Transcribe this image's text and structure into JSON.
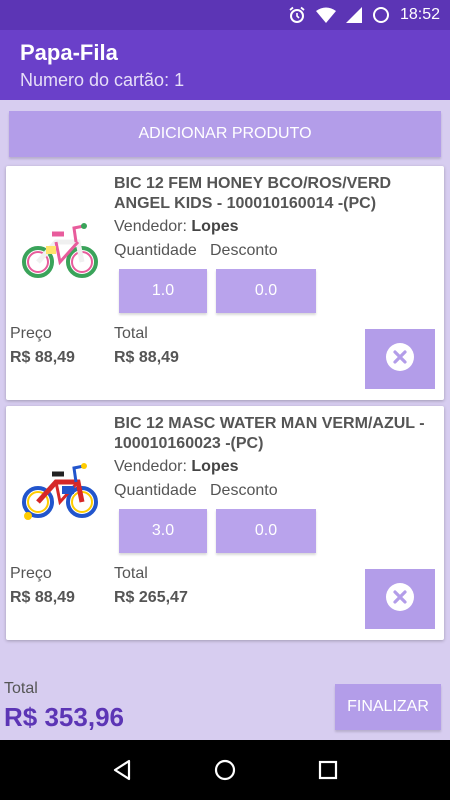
{
  "status_bar": {
    "time": "18:52",
    "icons": [
      "alarm-icon",
      "wifi-icon",
      "signal-icon",
      "battery-icon"
    ]
  },
  "app_bar": {
    "title": "Papa-Fila",
    "subtitle": "Numero do cartão: 1"
  },
  "actions": {
    "add_product": "ADICIONAR PRODUTO",
    "finalize": "FINALIZAR"
  },
  "labels": {
    "seller": "Vendedor:",
    "quantity": "Quantidade",
    "discount": "Desconto",
    "price": "Preço",
    "total": "Total"
  },
  "products": [
    {
      "description": "BIC 12 FEM HONEY BCO/ROS/VERD ANGEL KIDS - 100010160014 -(PC)",
      "seller": "Lopes",
      "quantity": "1.0",
      "discount": "0.0",
      "price": "R$ 88,49",
      "total": "R$ 88,49",
      "image": "pink-bicycle"
    },
    {
      "description": "BIC 12 MASC WATER MAN VERM/AZUL - 100010160023 -(PC)",
      "seller": "Lopes",
      "quantity": "3.0",
      "discount": "0.0",
      "price": "R$ 88,49",
      "total": "R$ 265,47",
      "image": "blue-red-bicycle"
    }
  ],
  "footer": {
    "label": "Total",
    "total": "R$ 353,96"
  },
  "colors": {
    "primary_dark": "#5c35b5",
    "primary": "#6a40c9",
    "accent": "#b39de9",
    "background": "#d7cdf0"
  },
  "nav": [
    "back-icon",
    "home-icon",
    "recents-icon"
  ]
}
